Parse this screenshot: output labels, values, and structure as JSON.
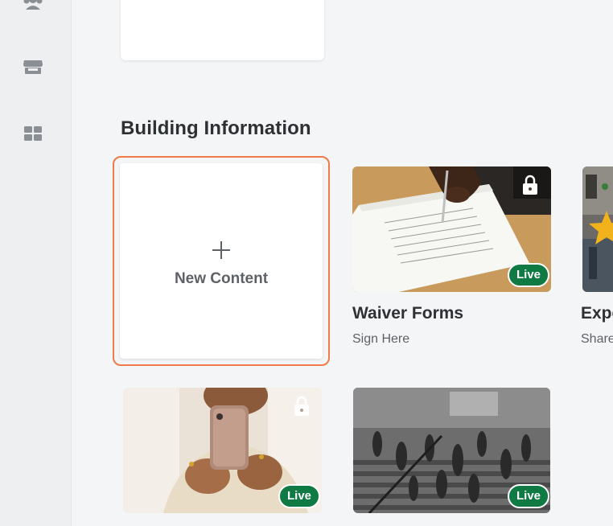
{
  "sidebar": {
    "items": [
      {
        "icon": "people-icon"
      },
      {
        "icon": "store-icon"
      },
      {
        "icon": "dashboard-grid-icon"
      }
    ]
  },
  "section": {
    "title": "Building Information"
  },
  "new_content": {
    "label": "New Content",
    "icon": "plus-icon"
  },
  "cards": [
    {
      "title": "Waiver Forms",
      "subtitle": "Sign Here",
      "badge": "Live",
      "locked": true,
      "image": "hand-signing-document"
    },
    {
      "title": "Expe",
      "subtitle": "Share",
      "badge": "",
      "locked": false,
      "image": "office-with-star"
    },
    {
      "title": "",
      "subtitle": "",
      "badge": "Live",
      "locked": true,
      "image": "woman-holding-phone"
    },
    {
      "title": "",
      "subtitle": "",
      "badge": "Live",
      "locked": false,
      "image": "crowd-on-stairs-bw"
    }
  ],
  "colors": {
    "accent_outline": "#f07a4a",
    "live_badge": "#0f7a43",
    "heading": "#2e3134",
    "muted": "#5e6266"
  }
}
